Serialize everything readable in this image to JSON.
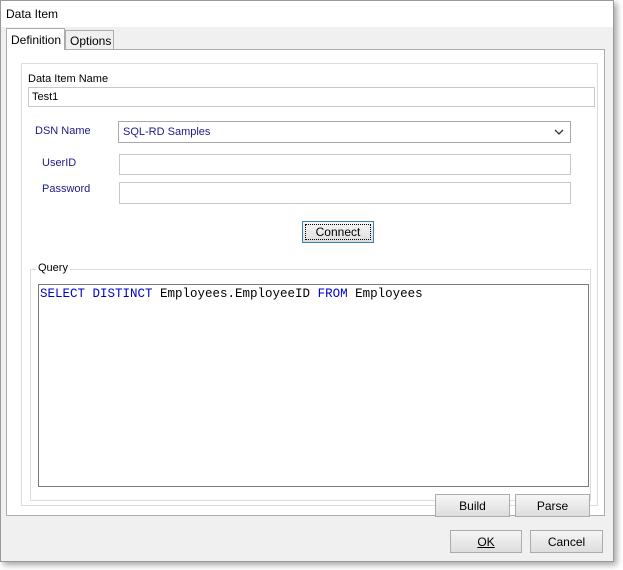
{
  "window": {
    "title": "Data Item"
  },
  "tabs": [
    {
      "label": "Definition",
      "active": true
    },
    {
      "label": "Options",
      "active": false
    }
  ],
  "form": {
    "data_item_name_label": "Data Item Name",
    "data_item_name_value": "Test1",
    "dsn_label": "DSN Name",
    "dsn_value": "SQL-RD Samples",
    "userid_label": "UserID",
    "userid_value": "",
    "password_label": "Password",
    "password_value": "",
    "connect_label": "Connect"
  },
  "query": {
    "legend": "Query",
    "tokens": [
      {
        "text": "SELECT DISTINCT",
        "keyword": true
      },
      {
        "text": " Employees.EmployeeID ",
        "keyword": false
      },
      {
        "text": "FROM",
        "keyword": true
      },
      {
        "text": " Employees",
        "keyword": false
      }
    ],
    "build_label": "Build",
    "parse_label": "Parse"
  },
  "footer": {
    "ok_label": "OK",
    "cancel_label": "Cancel"
  },
  "colors": {
    "keyword": "#0000cc",
    "label_blue": "#1a1a8c",
    "dialog_bg": "#f0f0f0"
  },
  "icons": {
    "dsn_dropdown": "chevron-down-icon"
  }
}
